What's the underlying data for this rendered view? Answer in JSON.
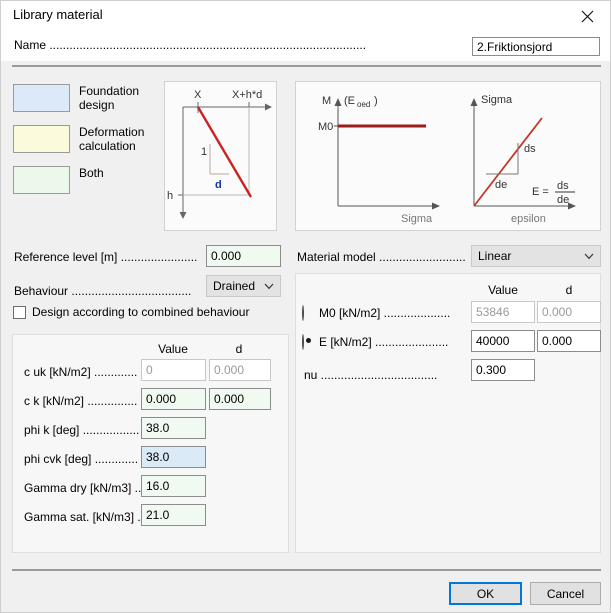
{
  "window": {
    "title": "Library material",
    "close_icon": "close-icon"
  },
  "name_row": {
    "label": "Name ...............................................................................................",
    "value": "2.Friktionsjord"
  },
  "legend": [
    {
      "label": "Foundation\ndesign",
      "color": "#dbe9f8"
    },
    {
      "label": "Deformation\ncalculation",
      "color": "#fcfadd"
    },
    {
      "label": "Both",
      "color": "#edf8ed"
    }
  ],
  "diagram_left": {
    "label_x": "X",
    "label_xhd": "X+h*d",
    "label_one": "1",
    "label_d": "d",
    "label_h": "h",
    "line_color": "#cc2222",
    "d_color": "#1133aa"
  },
  "diagram_right": {
    "chart1": {
      "y_axis": "M",
      "y_axis_sub": "(E",
      "y_axis_sub2": "oed",
      "y_axis_sub3": ")",
      "y_tick": "M0",
      "x_axis": "Sigma",
      "line_color": "#9c1b1b"
    },
    "chart2": {
      "y_axis": "Sigma",
      "x_axis": "epsilon",
      "label_ds": "ds",
      "label_de": "de",
      "formula_lhs": "E =",
      "formula_num": "ds",
      "formula_den": "de",
      "line_color": "#c0392b"
    }
  },
  "left_fields": {
    "reference_level": {
      "label": "Reference level [m] .......................",
      "value": "0.000"
    },
    "behaviour": {
      "label": "Behaviour ....................................",
      "value": "Drained",
      "arrow_icon": "chevron-down-icon"
    },
    "combined_behaviour": {
      "label": "Design according to combined behaviour",
      "checked": false
    }
  },
  "left_group": {
    "headers": {
      "value": "Value",
      "d": "d"
    },
    "rows": [
      {
        "label": "c uk [kN/m2] .............",
        "value": "0",
        "d": "0.000",
        "value_state": "disabled",
        "d_state": "disabled"
      },
      {
        "label": "c k [kN/m2] ...............",
        "value": "0.000",
        "d": "0.000",
        "value_state": "green",
        "d_state": "green"
      },
      {
        "label": "phi k [deg] .................",
        "value": "38.0",
        "d": null,
        "value_state": "green",
        "d_state": null
      },
      {
        "label": "phi cvk [deg] .............",
        "value": "38.0",
        "d": null,
        "value_state": "blue",
        "d_state": null
      },
      {
        "label": "Gamma dry [kN/m3] .....",
        "value": "16.0",
        "d": null,
        "value_state": "green",
        "d_state": null
      },
      {
        "label": "Gamma sat. [kN/m3] ....",
        "value": "21.0",
        "d": null,
        "value_state": "green",
        "d_state": null
      }
    ]
  },
  "material_model": {
    "label": "Material model ..........................",
    "value": "Linear",
    "arrow_icon": "chevron-down-icon"
  },
  "right_group": {
    "headers": {
      "value": "Value",
      "d": "d"
    },
    "rows": [
      {
        "type": "radio",
        "selected": false,
        "label": "M0 [kN/m2] ....................",
        "value": "53846",
        "d": "0.000",
        "value_state": "disabled",
        "d_state": "disabled"
      },
      {
        "type": "radio",
        "selected": true,
        "label": "E [kN/m2] ......................",
        "value": "40000",
        "d": "0.000",
        "value_state": "white",
        "d_state": "white"
      },
      {
        "type": "plain",
        "selected": null,
        "label": "nu ...................................",
        "value": "0.300",
        "d": null,
        "value_state": "white",
        "d_state": null
      }
    ]
  },
  "footer": {
    "ok": "OK",
    "cancel": "Cancel"
  },
  "colors": {
    "accent": "#0078d7",
    "panel": "#f0f0f0",
    "field_green": "#f0faf0",
    "field_blue": "#dbeaf7"
  }
}
